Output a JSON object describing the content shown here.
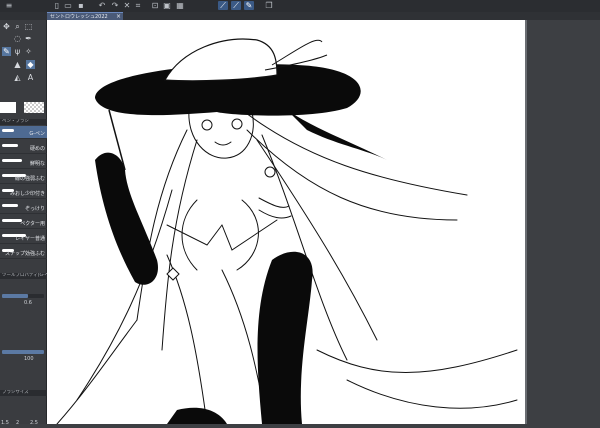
{
  "document_tab": {
    "title": "セントロウレッシュ2022",
    "close": "×"
  },
  "toolbar": {
    "icons": [
      "menu-icon",
      "new-icon",
      "open-icon",
      "save-icon",
      "undo-icon",
      "redo-icon",
      "clear-icon",
      "transform-icon",
      "deselect-icon",
      "invert-icon",
      "selection-icon",
      "snap-ruler-icon",
      "snap-special-icon",
      "pen-icon",
      "layer-icon"
    ]
  },
  "tools": {
    "row1": [
      "move",
      "zoom",
      "selection"
    ],
    "row2": [
      "lasso",
      "eyedropper"
    ],
    "row3": [
      "pen",
      "brush",
      "airbrush"
    ],
    "row4": [
      "fill",
      "blend"
    ],
    "row5": [
      "shape",
      "text"
    ]
  },
  "colors": {
    "main": "#ffffff",
    "sub": "transparent",
    "accent": "#56769f"
  },
  "subtool_header": "ペン・ブラシ",
  "brushes": [
    {
      "name": "G-ペン",
      "selected": true
    },
    {
      "name": "硬めの",
      "selected": false
    },
    {
      "name": "鮮明な",
      "selected": false
    },
    {
      "name": "線の強弱ふむ",
      "selected": false
    },
    {
      "name": "みおし少印付き",
      "selected": false
    },
    {
      "name": "ぞっけり",
      "selected": false
    },
    {
      "name": "ペクター用",
      "selected": false
    },
    {
      "name": "レイヤー普通",
      "selected": false
    },
    {
      "name": "スナップ効強ふむ",
      "selected": false
    }
  ],
  "property_header": "ツールプロパティ[G-ペン]",
  "properties": [
    {
      "label": "ブラシサイズ",
      "value": "0.6",
      "fill": 0.62
    },
    {
      "label": "不透明度",
      "value": "100",
      "fill": 1.0
    }
  ],
  "brush_size_header": "ブラシサイズ",
  "brush_sizes": [
    "1.5",
    "2",
    "2.5"
  ]
}
